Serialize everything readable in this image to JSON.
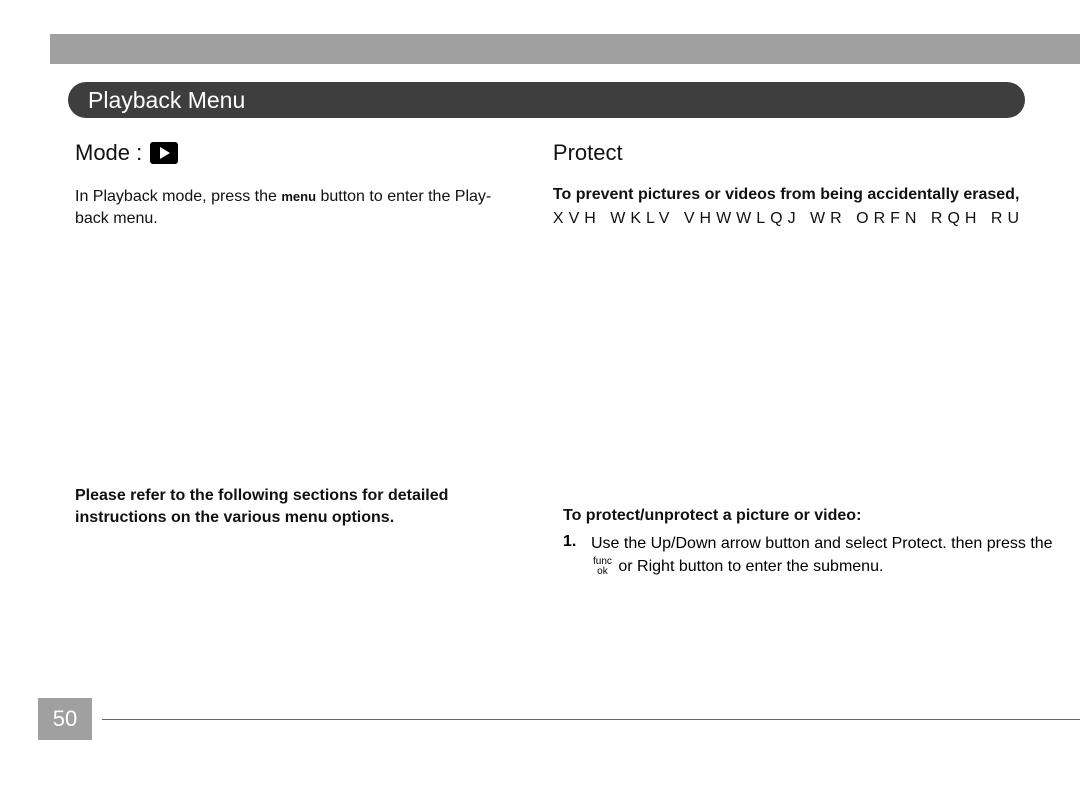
{
  "page_number": "50",
  "section_title": "Playback Menu",
  "left": {
    "mode_label": "Mode :",
    "intro_prefix": "In Playback mode, press the",
    "menu_word": "menu",
    "intro_suffix": "button to enter the Play-back menu.",
    "lower_text": "Please refer to the following sections for detailed instructions on the various menu options."
  },
  "right": {
    "heading": "Protect",
    "intro": "To prevent pictures or videos from being accidentally erased,",
    "cipher": "XVH WKLV VHWWLQJ WR ORFN RQH RU",
    "sub_heading": "To protect/unprotect a picture or video:",
    "step1_num": "1.",
    "step1_a": "Use the Up/Down arrow button and select Protect. then press the",
    "step1_b": "or Right button to enter the submenu.",
    "func_label_top": "func",
    "func_label_bot": "ok"
  }
}
